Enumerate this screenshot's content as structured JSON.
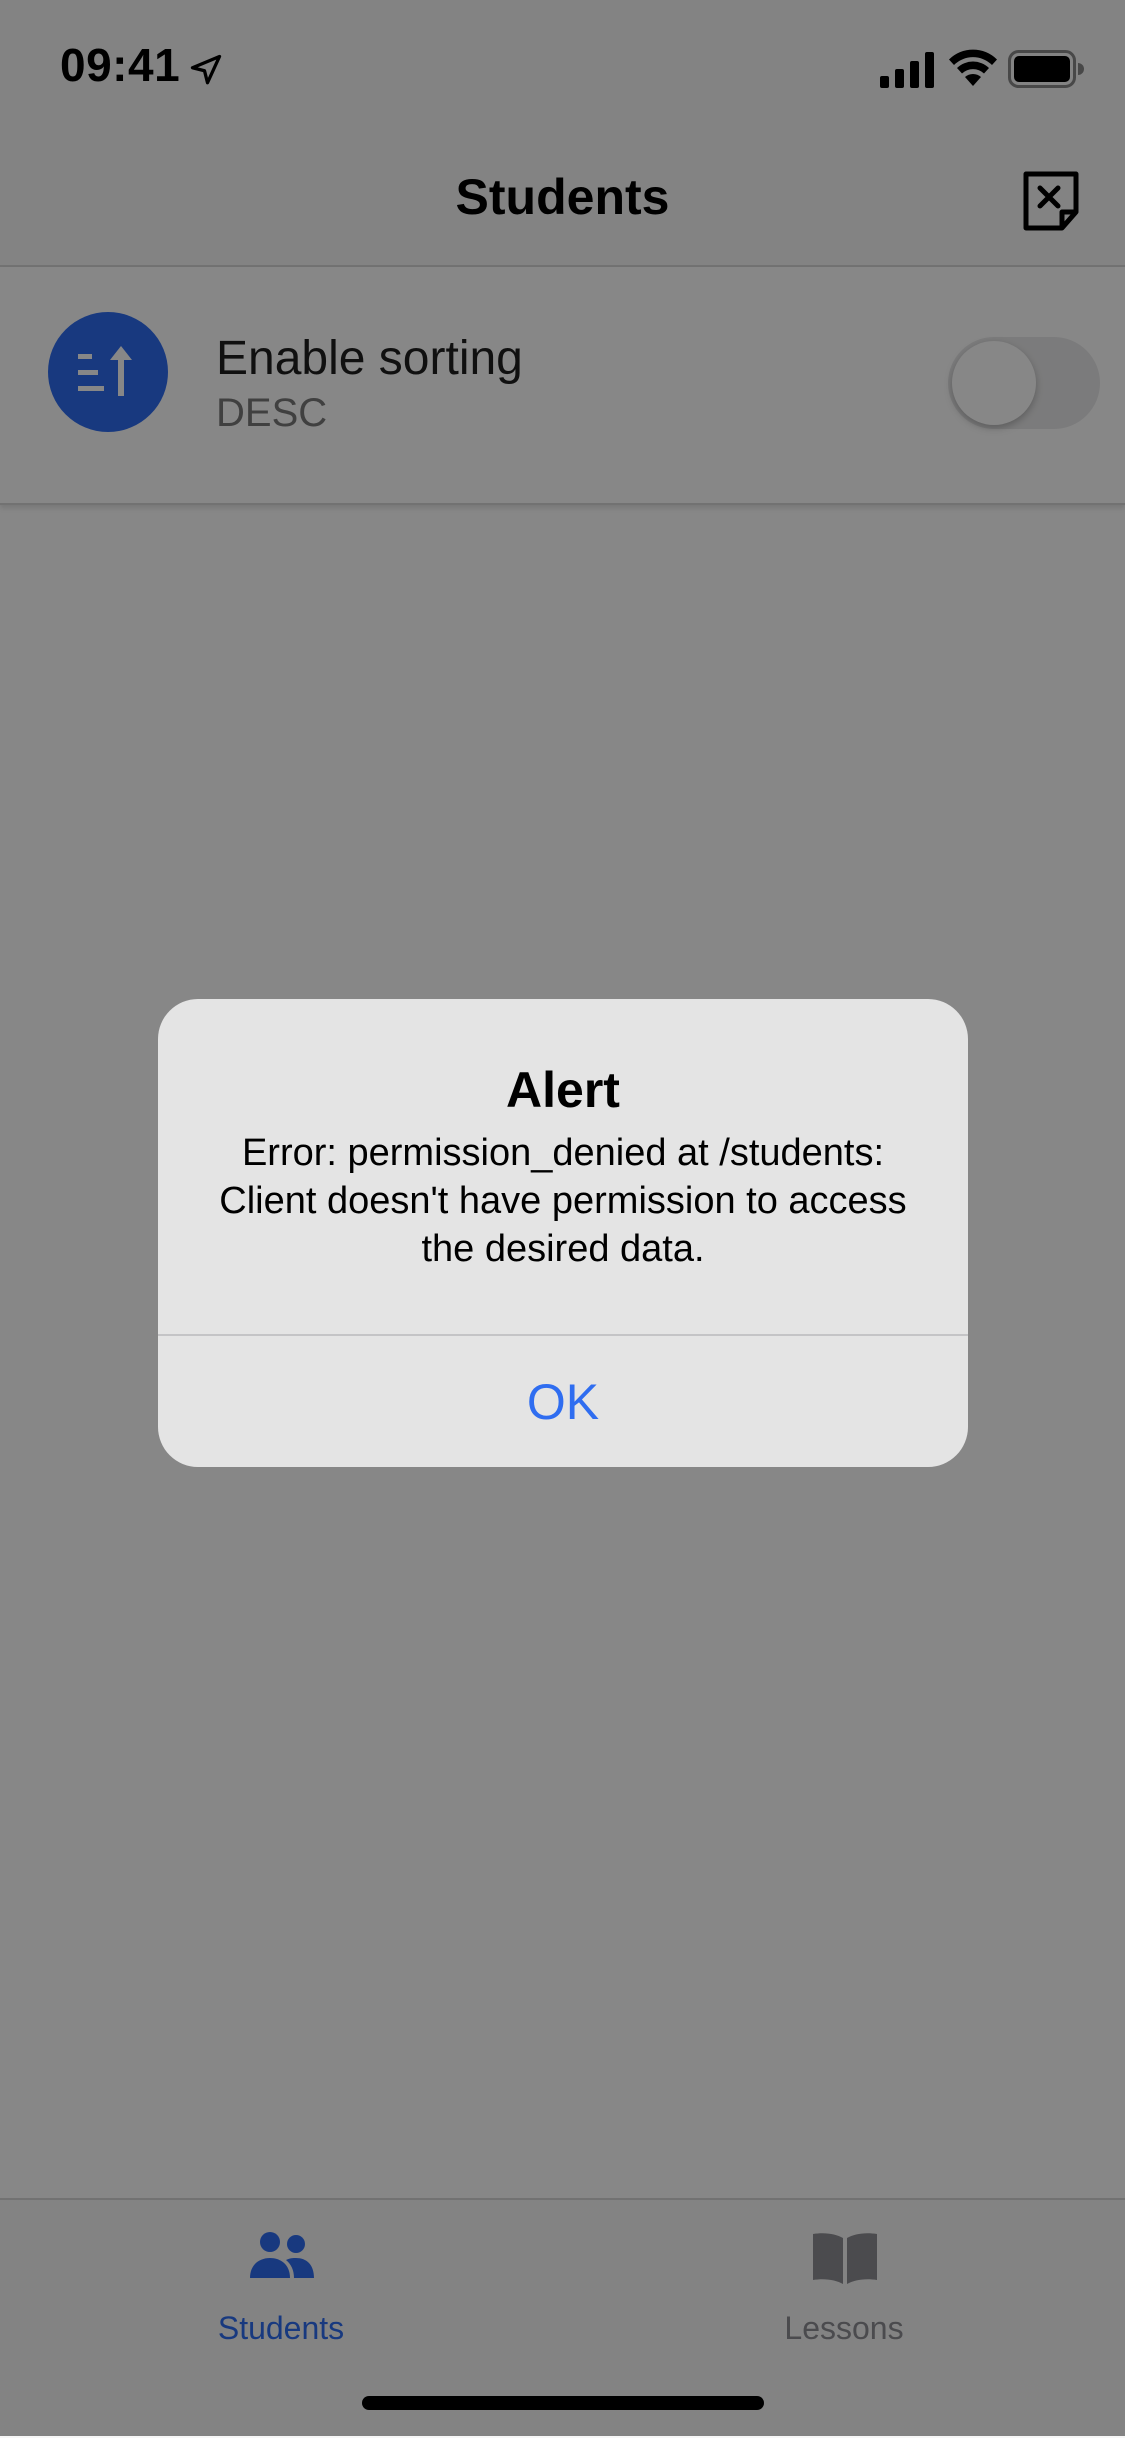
{
  "status_bar": {
    "time": "09:41"
  },
  "nav": {
    "title": "Students"
  },
  "sorting": {
    "title": "Enable sorting",
    "subtitle": "DESC",
    "enabled": false
  },
  "tabs": [
    {
      "label": "Students",
      "icon": "people-icon",
      "active": true
    },
    {
      "label": "Lessons",
      "icon": "book-icon",
      "active": false
    }
  ],
  "alert": {
    "title": "Alert",
    "message": "Error: permission_denied at /students: Client doesn't have permission to access the desired data.",
    "button": "OK"
  },
  "colors": {
    "accent": "#2f6df0",
    "inactive": "#8e8e93"
  }
}
